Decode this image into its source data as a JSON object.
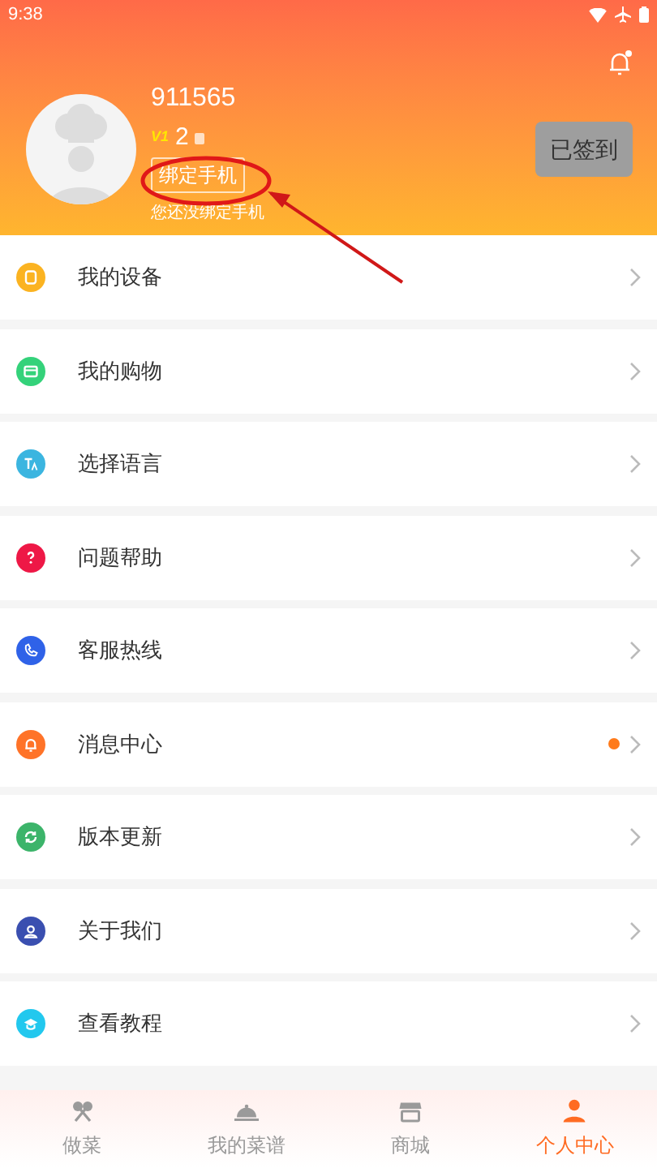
{
  "status_bar": {
    "time": "9:38"
  },
  "profile": {
    "username": "911565",
    "level_badge": "V1",
    "points": "2",
    "bind_button": "绑定手机",
    "bind_hint": "您还没绑定手机",
    "checkin_button": "已签到"
  },
  "menu": [
    {
      "label": "我的设备",
      "kind": "device",
      "color": "#fbb321",
      "badge": false
    },
    {
      "label": "我的购物",
      "kind": "shop",
      "color": "#34d27a",
      "badge": false
    },
    {
      "label": "选择语言",
      "kind": "language",
      "color": "#3bb5e0",
      "badge": false
    },
    {
      "label": "问题帮助",
      "kind": "help",
      "color": "#ee1846",
      "badge": false
    },
    {
      "label": "客服热线",
      "kind": "phone",
      "color": "#2f62e8",
      "badge": false
    },
    {
      "label": "消息中心",
      "kind": "bell",
      "color": "#ff7328",
      "badge": true
    },
    {
      "label": "版本更新",
      "kind": "update",
      "color": "#3cb46a",
      "badge": false
    },
    {
      "label": "关于我们",
      "kind": "about",
      "color": "#3a4fb0",
      "badge": false
    },
    {
      "label": "查看教程",
      "kind": "tutorial",
      "color": "#22c8ee",
      "badge": false
    }
  ],
  "bottom_nav": [
    {
      "label": "做菜",
      "kind": "cook",
      "selected": false
    },
    {
      "label": "我的菜谱",
      "kind": "recipes",
      "selected": false
    },
    {
      "label": "商城",
      "kind": "store",
      "selected": false
    },
    {
      "label": "个人中心",
      "kind": "profile",
      "selected": true
    }
  ]
}
